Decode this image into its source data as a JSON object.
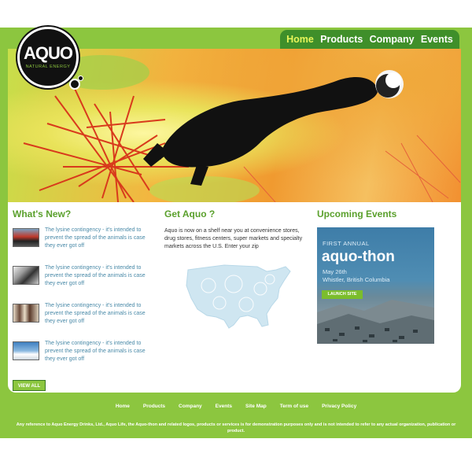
{
  "nav": {
    "items": [
      {
        "label": "Home",
        "active": true
      },
      {
        "label": "Products",
        "active": false
      },
      {
        "label": "Company",
        "active": false
      },
      {
        "label": "Events",
        "active": false
      }
    ]
  },
  "logo": {
    "brand": "AQUO",
    "tagline": "NATURAL ENERGY"
  },
  "whats_new": {
    "title": "What's New?",
    "items": [
      {
        "text": "The lysine contingency - it's intended to prevent the spread of the animals is case they ever got off",
        "thumb": "rider-photo"
      },
      {
        "text": "The lysine contingency - it's intended to prevent the spread of the animals is case they ever got off",
        "thumb": "crowd-photo"
      },
      {
        "text": "The lysine contingency - it's intended to prevent the spread of the animals is case they ever got off",
        "thumb": "runners-photo"
      },
      {
        "text": "The lysine contingency - it's intended to prevent the spread of the animals is case they ever got off",
        "thumb": "mountain-photo"
      }
    ],
    "view_all_label": "VIEW ALL"
  },
  "get_aquo": {
    "title": "Get Aquo ?",
    "text": "Aquo is now on a shelf near you at convenience stores, drug stores, fitness centers, super markets and specialty markets across the U.S. Enter your zip"
  },
  "events": {
    "title": "Upcoming Events",
    "promo": {
      "kicker": "FIRST ANNUAL",
      "name": "aquo-thon",
      "date": "May 26th",
      "place": "Whistler, British Columbia",
      "button": "LAUNCH SITE"
    }
  },
  "footer": {
    "links": [
      "Home",
      "Products",
      "Company",
      "Events",
      "Site Map",
      "Term of use",
      "Privacy Policy"
    ],
    "note": "Any reference to Aquo Energy Drinks, Ltd., Aquo Life, the Aquo-thon and related logos, products or services is for demonstration purposes only and is not intended to refer to any actual organization, publication or product."
  },
  "colors": {
    "brand_green": "#8cc63f",
    "nav_green": "#3f8f2a",
    "heading_green": "#5aa02c",
    "link_blue": "#4a8aa8"
  }
}
